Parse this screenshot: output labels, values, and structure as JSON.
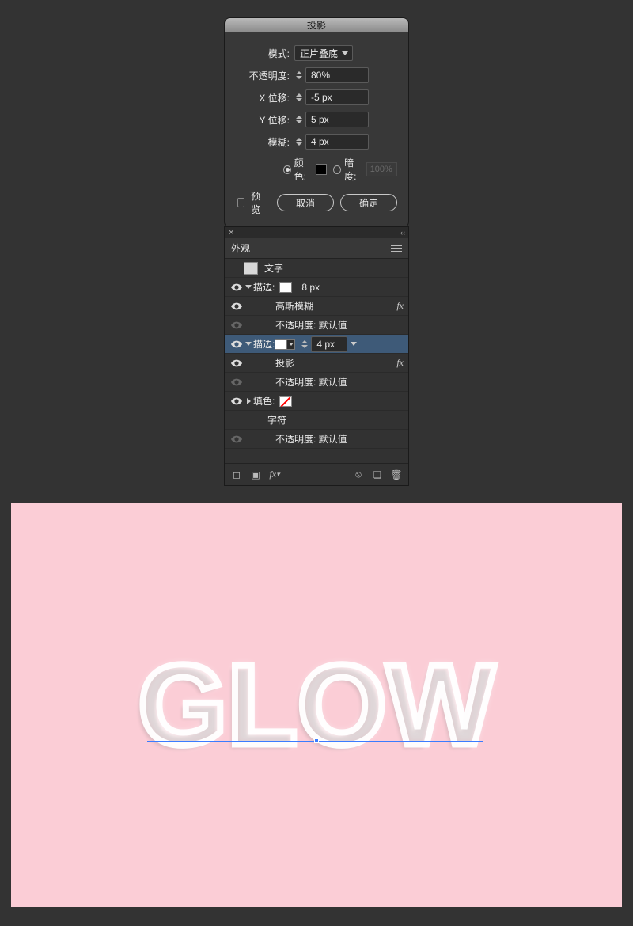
{
  "dialog": {
    "title": "投影",
    "mode_label": "模式:",
    "mode_value": "正片叠底",
    "opacity_label": "不透明度:",
    "opacity_value": "80%",
    "xoffset_label": "X 位移:",
    "xoffset_value": "-5 px",
    "yoffset_label": "Y 位移:",
    "yoffset_value": "5 px",
    "blur_label": "模糊:",
    "blur_value": "4 px",
    "color_label": "颜色:",
    "darkness_label": "暗度:",
    "darkness_value": "100%",
    "preview_label": "预览",
    "cancel": "取消",
    "ok": "确定"
  },
  "appearance": {
    "tab": "外观",
    "text_label": "文字",
    "stroke1": {
      "label": "描边:",
      "size": "8 px"
    },
    "gauss": "高斯模糊",
    "opacity_default": "不透明度: 默认值",
    "stroke2": {
      "label": "描边:",
      "size": "4 px"
    },
    "shadow": "投影",
    "fill_label": "填色:",
    "chars": "字符"
  },
  "canvas": {
    "text": "GLOW"
  },
  "colors": {
    "bg": "#333333",
    "panel": "#323232",
    "selected": "#3e5a78",
    "artboard": "#fbcdd6"
  }
}
